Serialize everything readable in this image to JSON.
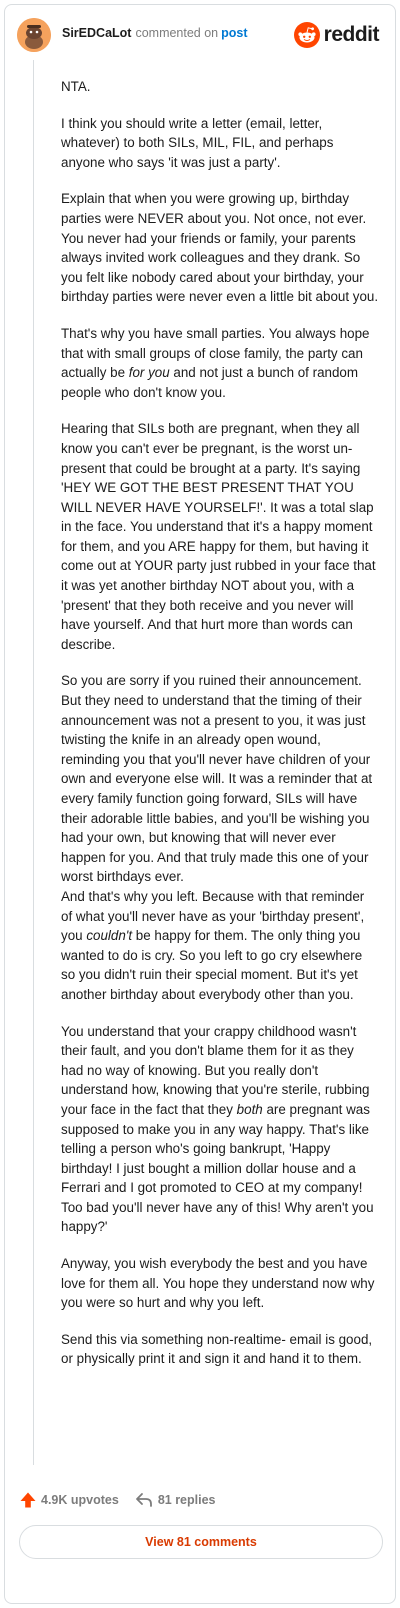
{
  "header": {
    "username": "SirEDCaLot",
    "verb": "commented on",
    "link_text": "post",
    "brand": "reddit",
    "avatar_icon": "snoo-avatar-icon",
    "brand_icon": "reddit-alien-icon"
  },
  "comment": {
    "p1": "NTA.",
    "p2": "I think you should write a letter (email, letter, whatever) to both SILs, MIL, FIL, and perhaps anyone who says 'it was just a party'.",
    "p3": "Explain that when you were growing up, birthday parties were NEVER about you. Not once, not ever. You never had your friends or family, your parents always invited work colleagues and they drank. So you felt like nobody cared about your birthday, your birthday parties were never even a little bit about you.",
    "p4_a": "That's why you have small parties. You always hope that with small groups of close family, the party can actually be ",
    "p4_em": "for you",
    "p4_b": " and not just a bunch of random people who don't know you.",
    "p5": "Hearing that SILs both are pregnant, when they all know you can't ever be pregnant, is the worst un-present that could be brought at a party. It's saying 'HEY WE GOT THE BEST PRESENT THAT YOU WILL NEVER HAVE YOURSELF!'. It was a total slap in the face. You understand that it's a happy moment for them, and you ARE happy for them, but having it come out at YOUR party just rubbed in your face that it was yet another birthday NOT about you, with a 'present' that they both receive and you never will have yourself. And that hurt more than words can describe.",
    "p6": "So you are sorry if you ruined their announcement. But they need to understand that the timing of their announcement was not a present to you, it was just twisting the knife in an already open wound, reminding you that you'll never have children of your own and everyone else will. It was a reminder that at every family function going forward, SILs will have their adorable little babies, and you'll be wishing you had your own, but knowing that will never ever happen for you. And that truly made this one of your worst birthdays ever.",
    "p7_a": "And that's why you left. Because with that reminder of what you'll never have as your 'birthday present', you ",
    "p7_em": "couldn't",
    "p7_b": " be happy for them. The only thing you wanted to do is cry. So you left to go cry elsewhere so you didn't ruin their special moment. But it's yet another birthday about everybody other than you.",
    "p8_a": "You understand that your crappy childhood wasn't their fault, and you don't blame them for it as they had no way of knowing. But you really don't understand how, knowing that you're sterile, rubbing your face in the fact that they ",
    "p8_em": "both",
    "p8_b": " are pregnant was supposed to make you in any way happy. That's like telling a person who's going bankrupt, 'Happy birthday! I just bought a million dollar house and a Ferrari and I got promoted to CEO at my company! Too bad you'll never have any of this! Why aren't you happy?'",
    "p9": "Anyway, you wish everybody the best and you have love for them all. You hope they understand now why you were so hurt and why you left.",
    "p10": "Send this via something non-realtime- email is good, or physically print it and sign it and hand it to them."
  },
  "actions": {
    "upvotes": "4.9K upvotes",
    "replies": "81 replies",
    "view_comments": "View 81 comments",
    "upvote_icon": "upvote-arrow-icon",
    "reply_icon": "reply-arrow-icon"
  },
  "colors": {
    "accent": "#ff4500",
    "link": "#0079d3",
    "view_button_text": "#d93a00",
    "muted": "#7c7c7c",
    "border": "#d9dde0"
  }
}
